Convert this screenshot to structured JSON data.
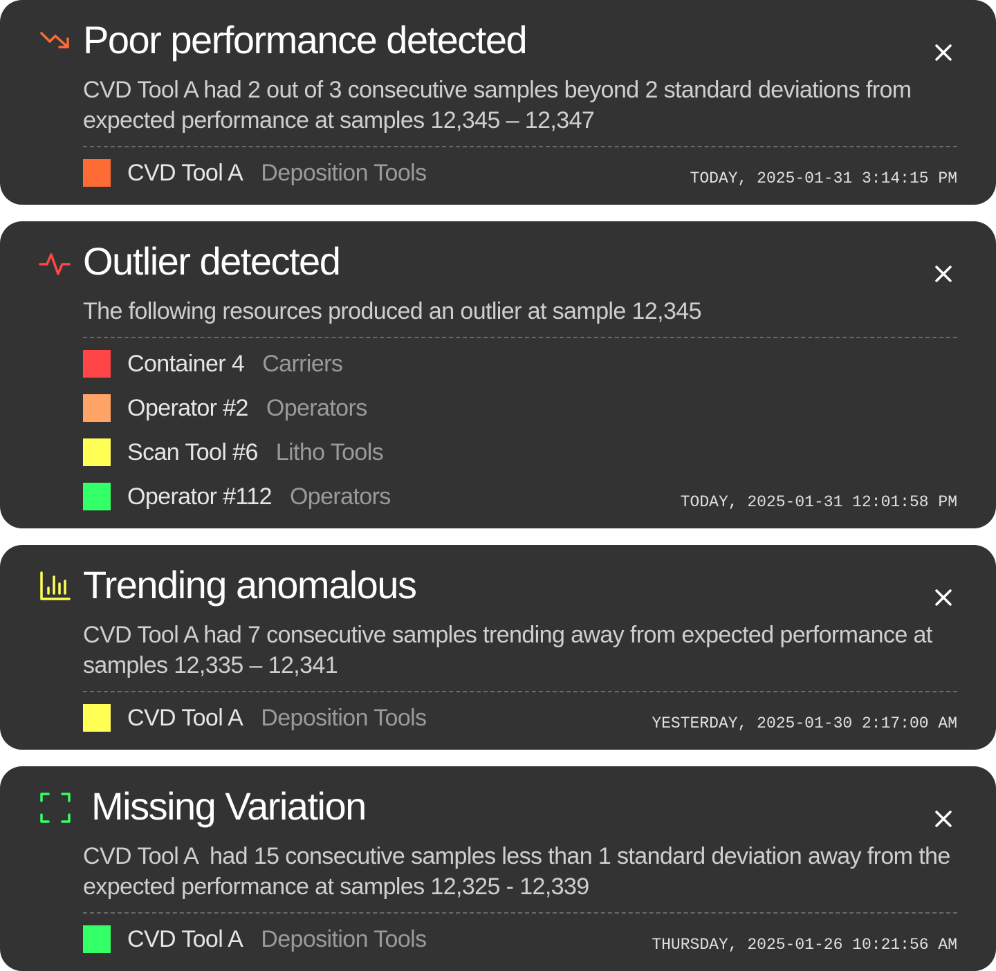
{
  "alerts": [
    {
      "type": "poor-performance",
      "icon": "trending-down-icon",
      "icon_color": "#FF6B35",
      "title": "Poor performance detected",
      "description": "CVD Tool A had 2 out of 3 consecutive samples beyond 2 standard deviations from expected performance at samples 12,345 – 12,347",
      "resources": [
        {
          "name": "CVD Tool A",
          "group": "Deposition Tools",
          "color": "#FF6B35"
        }
      ],
      "timestamp": "TODAY, 2025-01-31 3:14:15 PM"
    },
    {
      "type": "outlier",
      "icon": "pulse-icon",
      "icon_color": "#FF4545",
      "title": "Outlier detected",
      "description": "The following resources produced an outlier at sample 12,345",
      "resources": [
        {
          "name": "Container 4",
          "group": "Carriers",
          "color": "#FF4545"
        },
        {
          "name": "Operator #2",
          "group": "Operators",
          "color": "#FFA366"
        },
        {
          "name": "Scan Tool #6",
          "group": "Litho Tools",
          "color": "#FFFF55"
        },
        {
          "name": "Operator #112",
          "group": "Operators",
          "color": "#33FF66"
        }
      ],
      "timestamp": "TODAY, 2025-01-31 12:01:58 PM"
    },
    {
      "type": "trending-anomalous",
      "icon": "bar-chart-icon",
      "icon_color": "#FFFF55",
      "title": "Trending anomalous",
      "description": "CVD Tool A had 7 consecutive samples trending away from expected performance at samples 12,335 – 12,341",
      "resources": [
        {
          "name": "CVD Tool A",
          "group": "Deposition Tools",
          "color": "#FFFF55"
        }
      ],
      "timestamp": "YESTERDAY, 2025-01-30 2:17:00 AM"
    },
    {
      "type": "missing-variation",
      "icon": "focus-frame-icon",
      "icon_color": "#33FF66",
      "title": "Missing Variation",
      "description": "CVD Tool A  had 15 consecutive samples less than 1 standard deviation away from the expected performance at samples 12,325 - 12,339",
      "resources": [
        {
          "name": "CVD Tool A",
          "group": "Deposition Tools",
          "color": "#33FF66"
        }
      ],
      "timestamp": "THURSDAY, 2025-01-26 10:21:56 AM"
    }
  ]
}
